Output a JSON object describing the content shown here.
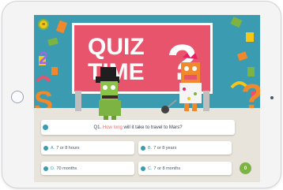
{
  "sign": {
    "line1": "QUIZ",
    "line2": "TIME",
    "mark": "?"
  },
  "menu": {
    "icon": "menu-icon",
    "glyph": "≡"
  },
  "question": {
    "number": "Q1.",
    "highlight": "How long",
    "rest": "will it take to travel to Mars?"
  },
  "answers": [
    {
      "letter": "A.",
      "text": "7 or 8 hours"
    },
    {
      "letter": "B.",
      "text": "7 or 8 years"
    },
    {
      "letter": "D.",
      "text": "70 months"
    },
    {
      "letter": "C.",
      "text": "7 or 8 months"
    }
  ],
  "timer": {
    "value": "0"
  },
  "colors": {
    "background": "#3b9bb0",
    "sign": "#e8546b",
    "accent": "#7cb342",
    "highlight": "#e57373"
  }
}
